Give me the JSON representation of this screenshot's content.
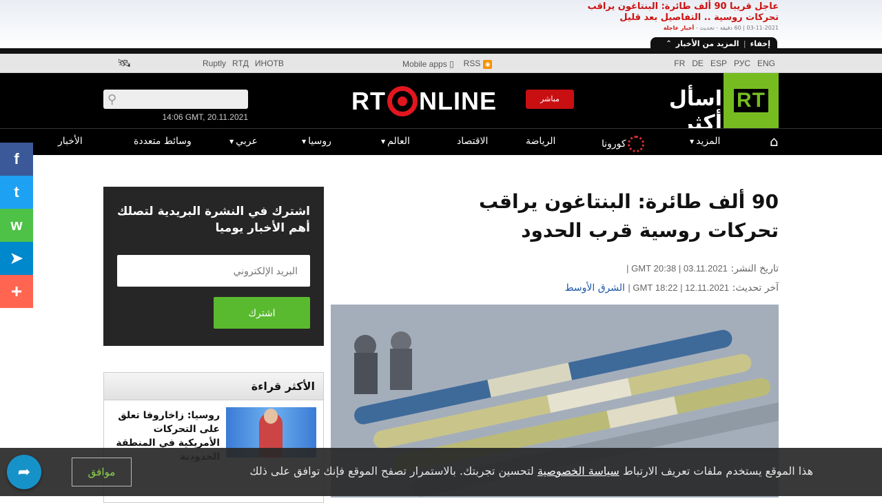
{
  "ticker": {
    "headline_line1": "عاجل قريبا 90 ألف طائرة: البنتاغون يراقب",
    "headline_line2": "تحركات روسية .. التفاصيل بعد قليل",
    "meta_date": "03-11-2021 | 60 دقيقة - تحديث",
    "meta_tag": "أخبار عاجلة",
    "hide_label": "إخفاء",
    "more_label": "المزيد من الأخبار"
  },
  "util": {
    "links": [
      "Ruptly",
      "RTД",
      "ИНОТВ"
    ],
    "mobile_apps": "Mobile apps",
    "rss": "RSS",
    "langs": [
      "FR",
      "DE",
      "ESP",
      "РУС",
      "ENG"
    ]
  },
  "header": {
    "date": "14:06 GMT, 20.11.2021",
    "logo_left": "RT",
    "logo_right": "NLINE",
    "live_label": "مباشر",
    "tagline": "اسأل أكثر",
    "rt_logo": "RT"
  },
  "nav": {
    "items": [
      {
        "label": "المزيد",
        "caret": true
      },
      {
        "label": "كورونا",
        "caret": false
      },
      {
        "label": "الرياضة",
        "caret": false
      },
      {
        "label": "الاقتصاد",
        "caret": false
      },
      {
        "label": "العالم",
        "caret": true
      },
      {
        "label": "روسيا",
        "caret": true
      },
      {
        "label": "عربي",
        "caret": true
      },
      {
        "label": "وسائط متعددة",
        "caret": false
      },
      {
        "label": "الأخبار",
        "caret": false
      }
    ]
  },
  "social": {
    "facebook": "f",
    "twitter": "t",
    "whatsapp": "w",
    "telegram": "➤",
    "more": "+"
  },
  "article": {
    "headline_line1": "90 ألف طائرة: البنتاغون يراقب",
    "headline_line2": "تحركات روسية قرب الحدود",
    "published_label": "تاريخ النشر:",
    "published_ts": "03.11.2021 | 20:38 GMT |",
    "updated_label": "آخر تحديث:",
    "updated_ts": "12.11.2021 | 18:22 GMT |",
    "updated_link": "الشرق الأوسط"
  },
  "newsletter": {
    "title": "اشترك في النشرة البريدية لتصلك أهم الأخبار يوميا",
    "placeholder": "البريد الإلكتروني",
    "button": "اشترك"
  },
  "newsbox": {
    "title": "الأكثر قراءة",
    "item_text": "روسيا: زاخاروفا تعلق على التحركات الأمريكية في المنطقة الحدودية"
  },
  "cookie": {
    "text_before": "هذا الموقع يستخدم ملفات تعريف الارتباط",
    "link": "سياسة الخصوصية",
    "text_after": "لتحسين تجربتك. بالاستمرار تصفح الموقع فإنك توافق على ذلك",
    "button": "موافق"
  }
}
